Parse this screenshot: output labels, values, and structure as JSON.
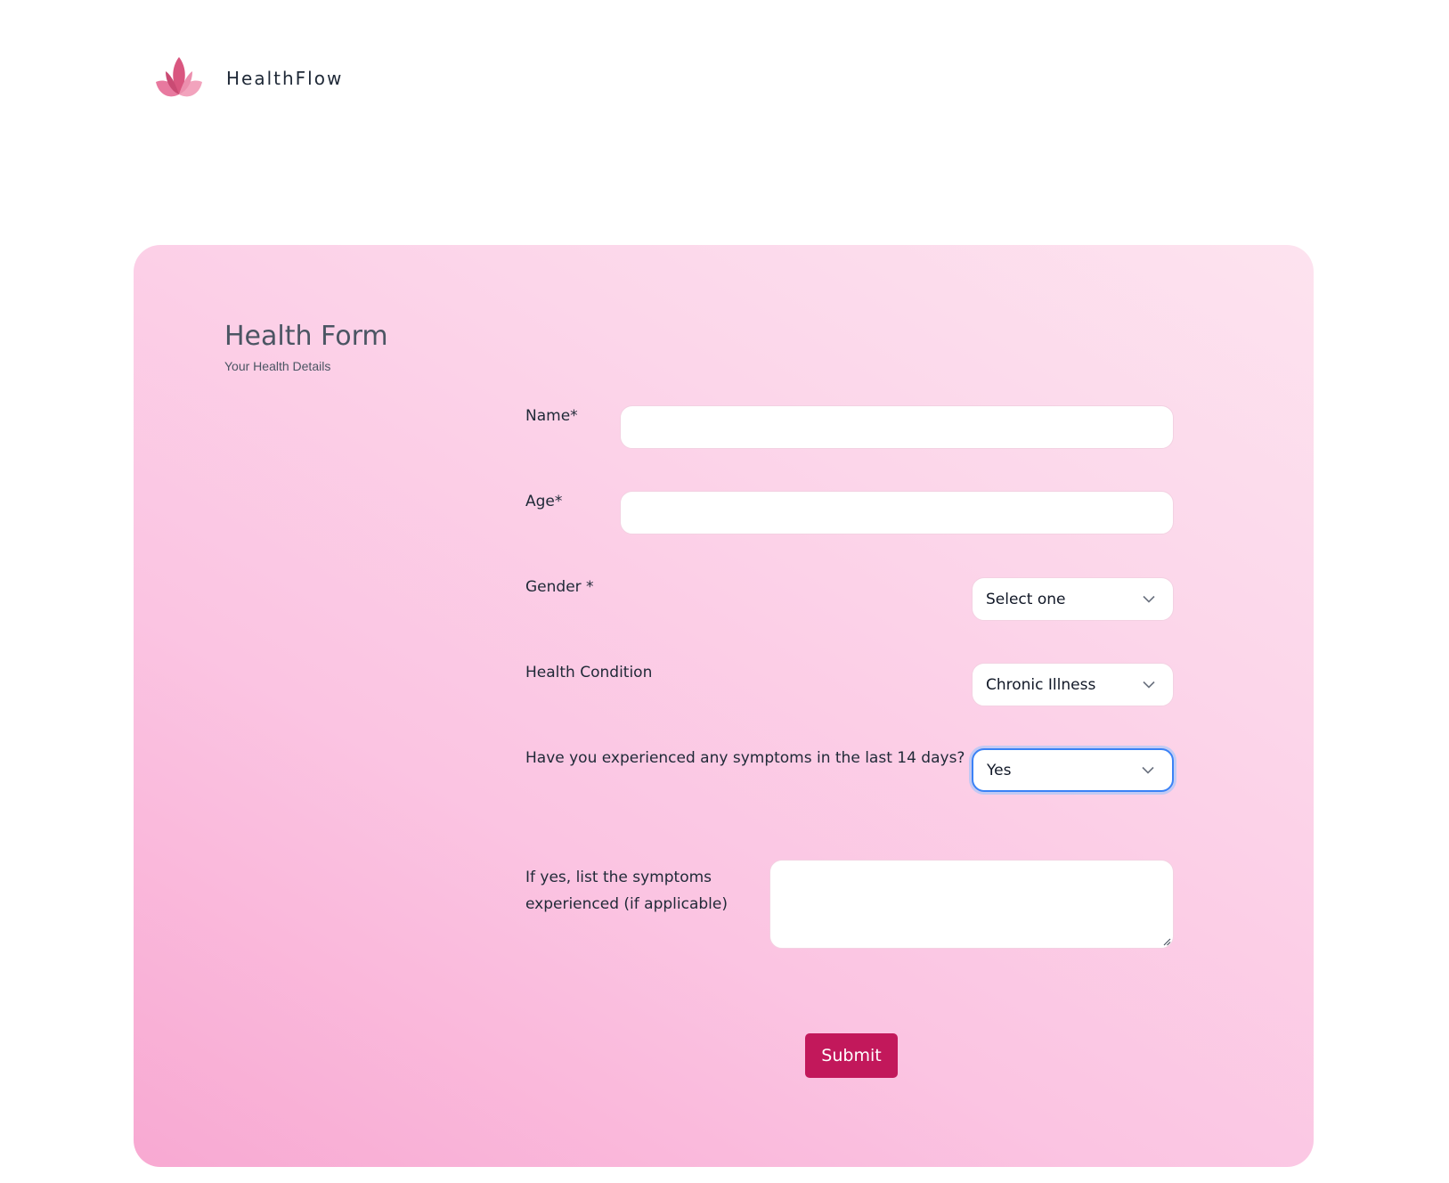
{
  "header": {
    "brand_name": "HealthFlow",
    "logo_icon": "lotus-icon",
    "logo_colors": [
      "#e8799f",
      "#d9567f",
      "#f2a3bd"
    ]
  },
  "form": {
    "title": "Health Form",
    "subtitle": "Your Health Details",
    "fields": {
      "name": {
        "label": "Name*",
        "value": "",
        "placeholder": ""
      },
      "age": {
        "label": "Age*",
        "value": "",
        "placeholder": ""
      },
      "gender": {
        "label": "Gender *",
        "selected": "Select one"
      },
      "health_condition": {
        "label": "Health Condition",
        "selected": "Chronic Illness"
      },
      "symptoms_recent": {
        "label": "Have you experienced any symptoms in the last 14 days?",
        "selected": "Yes"
      },
      "symptoms_list": {
        "label_line1": "If yes, list the symptoms",
        "label_line2": "experienced (if applicable)",
        "value": ""
      }
    },
    "submit_label": "Submit"
  },
  "colors": {
    "accent": "#c2185b",
    "focus_ring": "#3b82f6",
    "card_gradient": [
      "#f8a9d2",
      "#fde3ef"
    ]
  }
}
